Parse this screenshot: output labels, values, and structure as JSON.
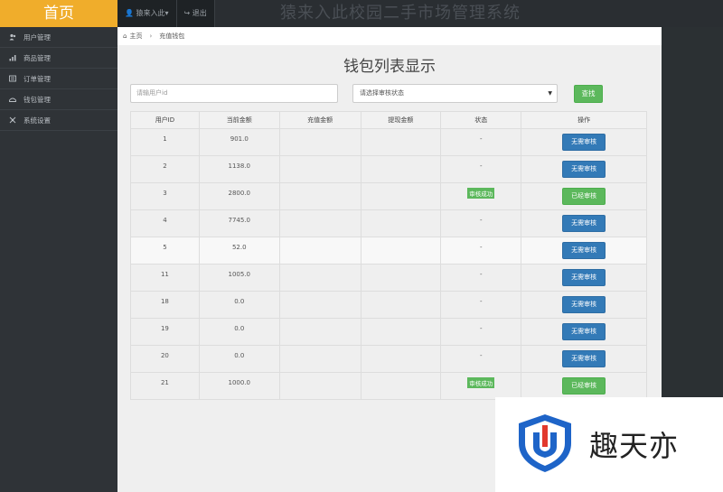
{
  "header": {
    "brand": "首页",
    "user_menu": "猿来入此▾",
    "logout": "退出",
    "system_title": "猿来入此校园二手市场管理系统"
  },
  "sidebar": {
    "items": [
      {
        "label": "用户管理",
        "icon": "users-icon"
      },
      {
        "label": "商品管理",
        "icon": "chart-icon"
      },
      {
        "label": "订单管理",
        "icon": "list-icon"
      },
      {
        "label": "钱包管理",
        "icon": "wallet-icon"
      },
      {
        "label": "系统设置",
        "icon": "settings-icon"
      }
    ]
  },
  "breadcrumb": {
    "home": "主页",
    "current": "充值钱包"
  },
  "page": {
    "title": "钱包列表显示"
  },
  "filters": {
    "user_id_placeholder": "请输用户id",
    "status_select": "请选择审核状态",
    "search_button": "查找"
  },
  "table": {
    "headers": [
      "用户ID",
      "当前金额",
      "充值金额",
      "提现金额",
      "状态",
      "操作"
    ],
    "rows": [
      {
        "id": "1",
        "balance": "901.0",
        "recharge": "",
        "withdraw": "",
        "status": "-",
        "status_badge": false,
        "op": "无需审核",
        "op_type": "blue"
      },
      {
        "id": "2",
        "balance": "1138.0",
        "recharge": "",
        "withdraw": "",
        "status": "-",
        "status_badge": false,
        "op": "无需审核",
        "op_type": "blue"
      },
      {
        "id": "3",
        "balance": "2800.0",
        "recharge": "",
        "withdraw": "",
        "status": "审核成功",
        "status_badge": true,
        "op": "已经审核",
        "op_type": "green"
      },
      {
        "id": "4",
        "balance": "7745.0",
        "recharge": "",
        "withdraw": "",
        "status": "-",
        "status_badge": false,
        "op": "无需审核",
        "op_type": "blue"
      },
      {
        "id": "5",
        "balance": "52.0",
        "recharge": "",
        "withdraw": "",
        "status": "-",
        "status_badge": false,
        "op": "无需审核",
        "op_type": "blue"
      },
      {
        "id": "11",
        "balance": "1005.0",
        "recharge": "",
        "withdraw": "",
        "status": "-",
        "status_badge": false,
        "op": "无需审核",
        "op_type": "blue"
      },
      {
        "id": "18",
        "balance": "0.0",
        "recharge": "",
        "withdraw": "",
        "status": "-",
        "status_badge": false,
        "op": "无需审核",
        "op_type": "blue"
      },
      {
        "id": "19",
        "balance": "0.0",
        "recharge": "",
        "withdraw": "",
        "status": "-",
        "status_badge": false,
        "op": "无需审核",
        "op_type": "blue"
      },
      {
        "id": "20",
        "balance": "0.0",
        "recharge": "",
        "withdraw": "",
        "status": "-",
        "status_badge": false,
        "op": "无需审核",
        "op_type": "blue"
      },
      {
        "id": "21",
        "balance": "1000.0",
        "recharge": "",
        "withdraw": "",
        "status": "审核成功",
        "status_badge": true,
        "op": "已经审核",
        "op_type": "green"
      }
    ]
  },
  "watermark": {
    "text": "趣天亦",
    "icon": "shield-logo-icon"
  },
  "colors": {
    "brand": "#f0ad2b",
    "primary_btn": "#337ab7",
    "success_btn": "#5cb85c",
    "sidebar_bg": "#2f3337"
  }
}
